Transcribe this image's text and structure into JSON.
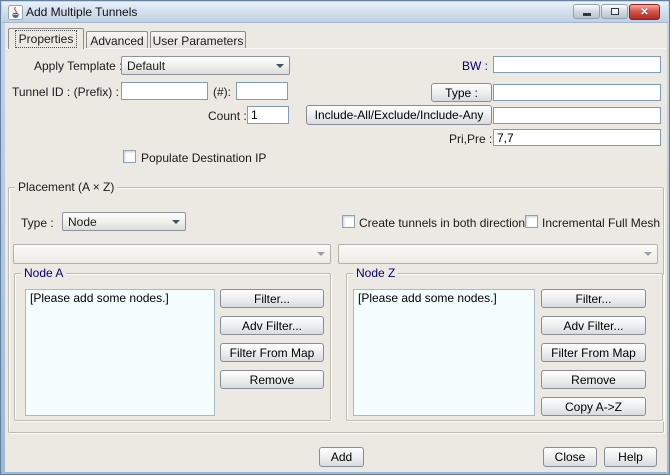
{
  "window": {
    "title": "Add Multiple Tunnels"
  },
  "icons": {
    "close": "✕"
  },
  "tabs": [
    {
      "label": "Properties"
    },
    {
      "label": "Advanced"
    },
    {
      "label": "User Parameters"
    }
  ],
  "properties_tab": {
    "apply_template_label": "Apply Template :",
    "apply_template_value": "Default",
    "bw_label": "BW :",
    "bw_value": "",
    "tunnel_id_label": "Tunnel ID :  (Prefix) :",
    "prefix_value": "",
    "hash_label": "(#):",
    "hash_value": "",
    "type_button_label": "Type :",
    "type_value": "",
    "count_label": "Count :",
    "count_value": "1",
    "include_button_label": "Include-All/Exclude/Include-Any",
    "include_value": "",
    "pri_pre_label": "Pri,Pre :",
    "pri_pre_value": "7,7",
    "populate_destination_ip_label": "Populate Destination IP"
  },
  "placement": {
    "title": "Placement (A × Z)",
    "type_label": "Type :",
    "type_value": "Node",
    "create_both_label": "Create tunnels in both directions",
    "incremental_label": "Incremental Full Mesh",
    "node_a": {
      "title": "Node A",
      "list_placeholder": "[Please add some nodes.]",
      "buttons": [
        "Filter...",
        "Adv Filter...",
        "Filter From Map",
        "Remove"
      ]
    },
    "node_z": {
      "title": "Node Z",
      "list_placeholder": "[Please add some nodes.]",
      "buttons": [
        "Filter...",
        "Adv Filter...",
        "Filter From Map",
        "Remove",
        "Copy A->Z"
      ]
    }
  },
  "footer": {
    "add_label": "Add",
    "close_label": "Close",
    "help_label": "Help"
  },
  "colors": {
    "navy_label": "#000080",
    "dialog_bg": "#ece9e2",
    "titlebar_gradient_top": "#e9f1f9",
    "titlebar_gradient_bottom": "#bfcfe2",
    "list_bg": "#f4feff",
    "close_button_red": "#b02a22",
    "frame_blue": "#9db9d6"
  }
}
